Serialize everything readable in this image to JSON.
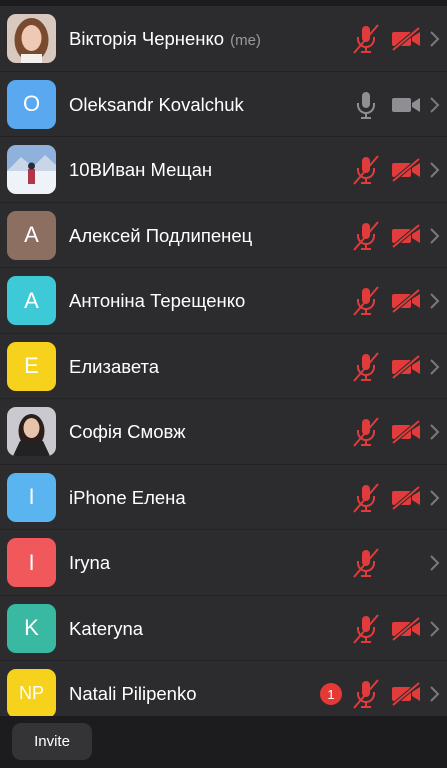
{
  "participants": [
    {
      "name": "Вікторія Черненко",
      "me_tag": "(me)",
      "avatar": {
        "type": "photo",
        "letter": "",
        "color": ""
      },
      "mic": "muted",
      "video": "off",
      "badge": ""
    },
    {
      "name": "Oleksandr Kovalchuk",
      "me_tag": "",
      "avatar": {
        "type": "letter",
        "letter": "O",
        "color": "#5aa8f0"
      },
      "mic": "on",
      "video": "on",
      "badge": ""
    },
    {
      "name": "10ВИван Мещан",
      "me_tag": "",
      "avatar": {
        "type": "photo",
        "letter": "",
        "color": ""
      },
      "mic": "muted",
      "video": "off",
      "badge": ""
    },
    {
      "name": "Алексей Подлипенец",
      "me_tag": "",
      "avatar": {
        "type": "letter",
        "letter": "A",
        "color": "#8c6f61"
      },
      "mic": "muted",
      "video": "off",
      "badge": ""
    },
    {
      "name": "Антоніна Терещенко",
      "me_tag": "",
      "avatar": {
        "type": "letter",
        "letter": "A",
        "color": "#3ec9d6"
      },
      "mic": "muted",
      "video": "off",
      "badge": ""
    },
    {
      "name": "Елизавета",
      "me_tag": "",
      "avatar": {
        "type": "letter",
        "letter": "E",
        "color": "#f6d21c"
      },
      "mic": "muted",
      "video": "off",
      "badge": ""
    },
    {
      "name": "Софія Смовж",
      "me_tag": "",
      "avatar": {
        "type": "photo",
        "letter": "",
        "color": ""
      },
      "mic": "muted",
      "video": "off",
      "badge": ""
    },
    {
      "name": "iPhone Елена",
      "me_tag": "",
      "avatar": {
        "type": "letter",
        "letter": "I",
        "color": "#5ab4f0"
      },
      "mic": "muted",
      "video": "off",
      "badge": ""
    },
    {
      "name": "Iryna",
      "me_tag": "",
      "avatar": {
        "type": "letter",
        "letter": "I",
        "color": "#f0585c"
      },
      "mic": "muted",
      "video": "none",
      "badge": ""
    },
    {
      "name": "Kateryna",
      "me_tag": "",
      "avatar": {
        "type": "letter",
        "letter": "K",
        "color": "#3ab9a2"
      },
      "mic": "muted",
      "video": "off",
      "badge": ""
    },
    {
      "name": "Natali Pilipenko",
      "me_tag": "",
      "avatar": {
        "type": "letter",
        "letter": "NP",
        "color": "#f6d21c"
      },
      "mic": "muted",
      "video": "off",
      "badge": "1"
    }
  ],
  "footer": {
    "invite_label": "Invite"
  },
  "colors": {
    "muted_red": "#e23b3b",
    "active_gray": "#8e8e93",
    "row_bg": "#2c2c2e",
    "page_bg": "#1c1c1e"
  },
  "icons": {
    "mic": "microphone-icon",
    "mic_muted": "microphone-muted-icon",
    "video": "video-camera-icon",
    "video_off": "video-camera-off-icon",
    "chevron": "chevron-right-icon"
  }
}
